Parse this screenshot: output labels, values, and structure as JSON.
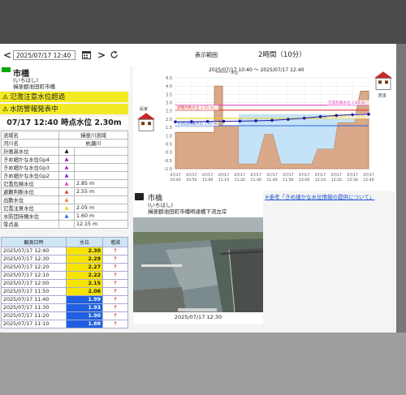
{
  "toolbar": {
    "prev": "<",
    "date_value": "2025/07/17 12:40",
    "next": ">",
    "range_label": "表示範囲",
    "range_value": "2時間（10分）"
  },
  "station": {
    "name": "市橋",
    "kana": "(いちはし)",
    "address": "揖斐郡池田町市橋"
  },
  "warnings": [
    {
      "icon": "⚠",
      "text": "氾濫注意水位超過"
    },
    {
      "icon": "⚠",
      "text": "水防警報発表中"
    }
  ],
  "current": "07/17 12:40 時点水位 2.30m",
  "info_rows": [
    {
      "key": "流域名",
      "value": "揖斐川流域",
      "sym": "",
      "color": ""
    },
    {
      "key": "河川名",
      "value": "杭瀬川",
      "sym": "",
      "color": ""
    },
    {
      "key": "計画高水位",
      "value": "",
      "sym": "▲",
      "color": "#000000"
    },
    {
      "key": "きめ細かな水位Gp4",
      "value": "",
      "sym": "▲",
      "color": "#8b1fa9"
    },
    {
      "key": "きめ細かな水位Gp3",
      "value": "",
      "sym": "▲",
      "color": "#c21fc2"
    },
    {
      "key": "きめ細かな水位Gp2",
      "value": "",
      "sym": "▲",
      "color": "#7a2fd6"
    },
    {
      "key": "氾濫危険水位",
      "value": "2.85 m",
      "sym": "▲",
      "color": "#e040c0"
    },
    {
      "key": "避難判断水位",
      "value": "2.55 m",
      "sym": "▲",
      "color": "#e53935"
    },
    {
      "key": "出動水位",
      "value": "",
      "sym": "▲",
      "color": "#f08030"
    },
    {
      "key": "氾濫注意水位",
      "value": "2.05 m",
      "sym": "▲",
      "color": "#f2d21a"
    },
    {
      "key": "水防団待機水位",
      "value": "1.60 m",
      "sym": "▲",
      "color": "#2a64e0"
    },
    {
      "key": "零点高",
      "value": "12.15 m",
      "sym": "",
      "color": ""
    }
  ],
  "obs_header": {
    "time": "観測日時",
    "level": "水位",
    "trend": "増減"
  },
  "observations": [
    {
      "time": "2025/07/17 12:40",
      "level": "2.30",
      "trend": "↑",
      "bg": "#f6e400"
    },
    {
      "time": "2025/07/17 12:30",
      "level": "2.29",
      "trend": "↑",
      "bg": "#f6e400"
    },
    {
      "time": "2025/07/17 12:20",
      "level": "2.27",
      "trend": "↑",
      "bg": "#f6e400"
    },
    {
      "time": "2025/07/17 12:10",
      "level": "2.22",
      "trend": "↑",
      "bg": "#f6e400"
    },
    {
      "time": "2025/07/17 12:00",
      "level": "2.15",
      "trend": "↑",
      "bg": "#f6e400"
    },
    {
      "time": "2025/07/17 11:50",
      "level": "2.06",
      "trend": "↑",
      "bg": "#f6e400"
    },
    {
      "time": "2025/07/17 11:40",
      "level": "1.99",
      "trend": "↑",
      "bg": "#1f5fe0"
    },
    {
      "time": "2025/07/17 11:30",
      "level": "1.93",
      "trend": "↑",
      "bg": "#1f5fe0"
    },
    {
      "time": "2025/07/17 11:20",
      "level": "1.90",
      "trend": "↑",
      "bg": "#1f5fe0"
    },
    {
      "time": "2025/07/17 11:10",
      "level": "1.88",
      "trend": "↑",
      "bg": "#1f5fe0"
    }
  ],
  "chart_data": {
    "type": "line",
    "title": "2025/07/17 10:40 ～ 2025/07/17 12:40",
    "legend": "水位",
    "x": [
      "07/17 10:40",
      "07/17 10:50",
      "07/17 11:00",
      "07/17 11:10",
      "07/17 11:20",
      "07/17 11:30",
      "07/17 11:40",
      "07/17 11:50",
      "07/17 12:00",
      "07/17 12:10",
      "07/17 12:20",
      "07/17 12:30",
      "07/17 12:40"
    ],
    "values": [
      1.84,
      1.85,
      1.86,
      1.87,
      1.88,
      1.9,
      1.93,
      1.99,
      2.06,
      2.15,
      2.22,
      2.27,
      2.3
    ],
    "ylim": [
      -1.0,
      4.5
    ],
    "yticks": [
      "4.5",
      "4.0",
      "3.5",
      "3.0",
      "2.5",
      "2.0",
      "1.5",
      "1.0",
      "0.5",
      "0.0",
      "-0.5",
      "-1.0"
    ],
    "thresholds": [
      {
        "label": "氾濫危険水位 2.85 m",
        "value": 2.85,
        "color": "#e040c0"
      },
      {
        "label": "避難判断水位 2.55 m",
        "value": 2.55,
        "color": "#e53935"
      },
      {
        "label": "氾濫注意水位 2.05 m",
        "value": 2.05,
        "color": "#f2d21a"
      },
      {
        "label": "水防団待機水位 1.60 m",
        "value": 1.6,
        "color": "#2a64e0"
      }
    ],
    "house_label": "民家",
    "line_color": "#1a1aa0",
    "grid": true
  },
  "camera": {
    "name": "市橋",
    "kana": "(いちはし)",
    "location": "揖斐郡池田町市橋明達橋下流左岸",
    "caption": "2025/07/17 12:30"
  },
  "reference_link": "※参考「きめ細かな水位情報の提供について」"
}
